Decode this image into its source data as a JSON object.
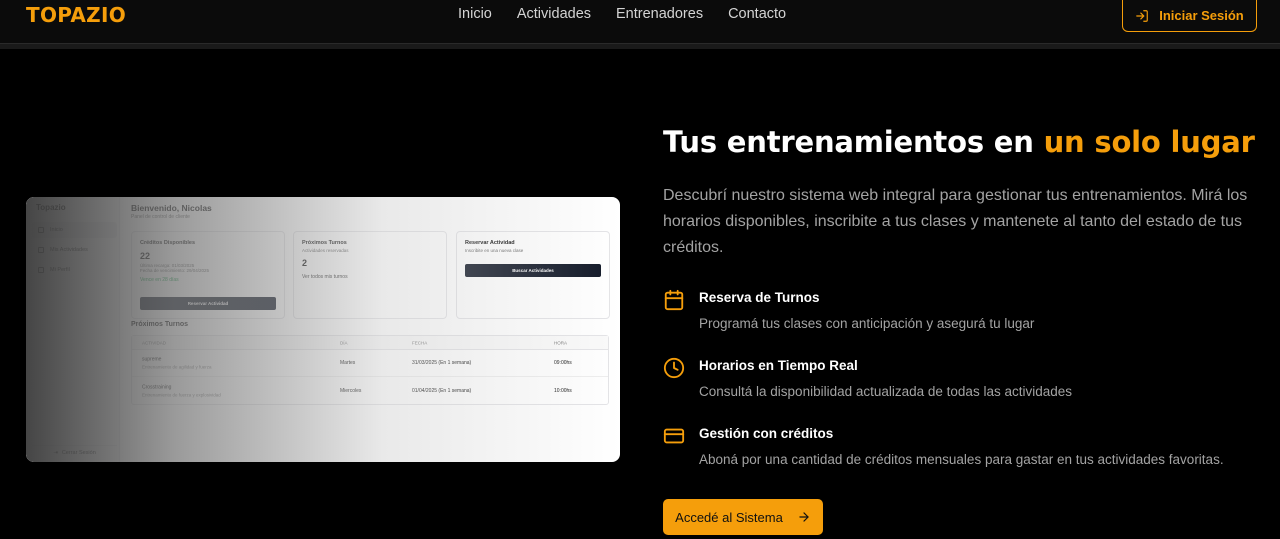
{
  "nav": {
    "logo": "TOPAZIO",
    "links": [
      "Inicio",
      "Actividades",
      "Entrenadores",
      "Contacto"
    ],
    "login_label": "Iniciar Sesión"
  },
  "preview": {
    "brand": "Topazio",
    "sidebar": [
      "Inicio",
      "Mis Actividades",
      "Mi Perfil"
    ],
    "logout": "Cerrar Sesión",
    "welcome": "Bienvenido, Nicolas",
    "subtitle": "Panel de control de cliente",
    "credits_card": {
      "title": "Créditos Disponibles",
      "value": "22",
      "last_charge": "Última recarga: 01/03/2025",
      "expiry_date": "Fecha de vencimiento: 29/04/2025",
      "expires_in": "Vence en 28 días",
      "button": "Reservar Actividad"
    },
    "turns_card": {
      "title": "Próximos Turnos",
      "subtitle": "Actividades reservadas",
      "value": "2",
      "link": "Ver todos mis turnos"
    },
    "reserve_card": {
      "title": "Reservar Actividad",
      "subtitle": "Inscribite en una nueva clase",
      "button": "Buscar Actividades"
    },
    "table_title": "Próximos Turnos",
    "table_headers": [
      "ACTIVIDAD",
      "DÍA",
      "FECHA",
      "HORA"
    ],
    "table_rows": [
      {
        "activity": "supreme",
        "desc": "Entrenamiento de agilidad y fuerza",
        "day": "Martes",
        "date": "31/03/2025 (En 1 semana)",
        "time": "09:00hs"
      },
      {
        "activity": "Crosstraining",
        "desc": "Entrenamiento de fuerza y explosividad",
        "day": "Miercoles",
        "date": "01/04/2025 (En 1 semana)",
        "time": "10:00hs"
      }
    ]
  },
  "hero": {
    "title_main": "Tus entrenamientos en ",
    "title_accent": "un solo lugar",
    "description": "Descubrí nuestro sistema web integral para gestionar tus entrenamientos. Mirá los horarios disponibles, inscribite a tus clases y mantenete al tanto del estado de tus créditos."
  },
  "features": [
    {
      "icon": "calendar-icon",
      "title": "Reserva de Turnos",
      "desc": "Programá tus clases con anticipación y asegurá tu lugar"
    },
    {
      "icon": "clock-icon",
      "title": "Horarios en Tiempo Real",
      "desc": "Consultá la disponibilidad actualizada de todas las actividades"
    },
    {
      "icon": "credit-card-icon",
      "title": "Gestión con créditos",
      "desc": "Aboná por una cantidad de créditos mensuales para gastar en tus actividades favoritas."
    }
  ],
  "cta_label": "Accedé al Sistema",
  "colors": {
    "accent": "#f59e0b",
    "background": "#000000"
  }
}
